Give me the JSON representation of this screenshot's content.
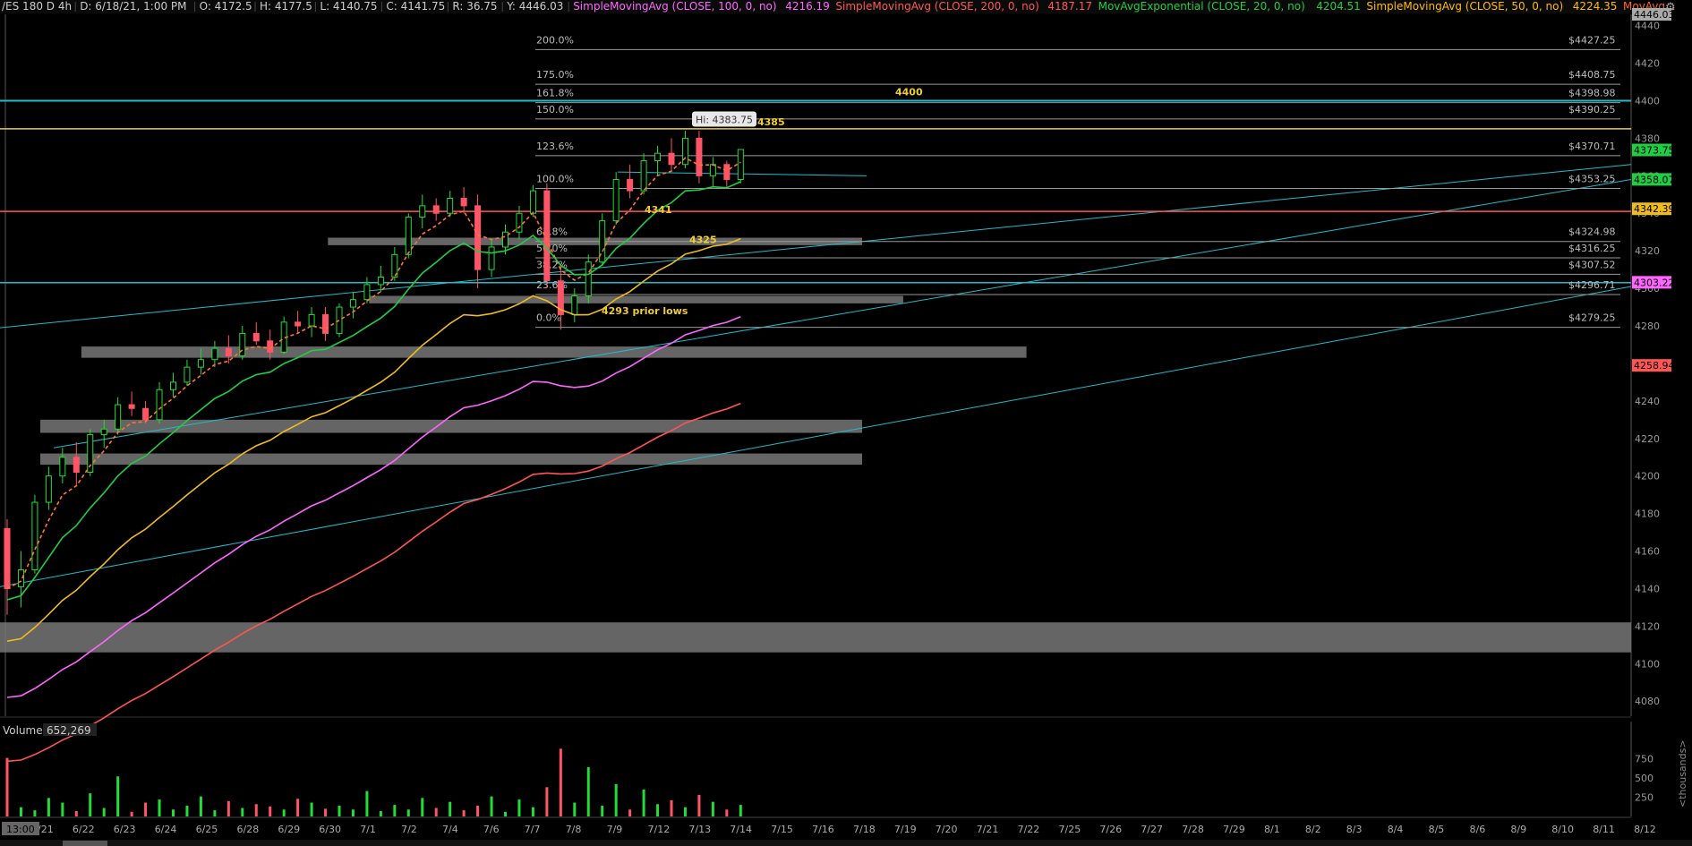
{
  "header": {
    "symbol": "/ES 180 D 4h",
    "date": "D: 6/18/21, 1:00 PM",
    "ohlc": "O: 4172.5",
    "high": "H: 4177.5",
    "low": "L: 4140.75",
    "close": "C: 4141.75",
    "range": "R: 36.75",
    "cursor_y": "Y: 4446.03",
    "studies": [
      {
        "label": "SimpleMovingAvg (CLOSE, 100, 0, no)",
        "value": "4216.19",
        "color": "#ff66ff"
      },
      {
        "label": "SimpleMovingAvg (CLOSE, 200, 0, no)",
        "value": "4187.17",
        "color": "#ff5555"
      },
      {
        "label": "MovAvgExponential (CLOSE, 20, 0, no)",
        "value": "4204.51",
        "color": "#22cc44"
      },
      {
        "label": "SimpleMovingAvg (CLOSE, 50, 0, no)",
        "value": "4224.35",
        "color": "#ffbb00"
      },
      {
        "label": "MovAvg...",
        "value": "",
        "color": "#ff6622"
      }
    ]
  },
  "colors": {
    "up": "#22dd33",
    "down": "#ff5566",
    "ema20": "#22cc44",
    "sma50": "#eebb22",
    "sma100": "#ff66ff",
    "sma200": "#ff5555",
    "trend": "#22bbcc",
    "yellow_line": "#eecc33",
    "fib": "#999999",
    "zone": "#777777"
  },
  "chart_data": [
    {
      "type": "candlestick",
      "x": {
        "ticks": [
          "6/21",
          "6/22",
          "6/23",
          "6/24",
          "6/25",
          "6/28",
          "6/29",
          "6/30",
          "7/1",
          "7/2",
          "7/4",
          "7/6",
          "7/7",
          "7/8",
          "7/9",
          "7/12",
          "7/13",
          "7/14",
          "7/15",
          "7/16",
          "7/18",
          "7/19",
          "7/20",
          "7/21",
          "7/22",
          "7/25",
          "7/26",
          "7/27",
          "7/28",
          "7/29",
          "8/1",
          "8/2",
          "8/3",
          "8/4",
          "8/5",
          "8/6",
          "8/9",
          "8/10",
          "8/11",
          "8/12"
        ],
        "cursor_label": "13:00"
      },
      "y": {
        "range": [
          4072,
          4446.03
        ],
        "ticks": [
          4080,
          4100,
          4120,
          4140,
          4160,
          4180,
          4200,
          4220,
          4240,
          4260,
          4280,
          4300,
          4320,
          4340,
          4360,
          4380,
          4400,
          4420,
          4440
        ],
        "right_flags": [
          {
            "label": "4446.03",
            "value": 4446.03,
            "color": "#aaaaaa"
          },
          {
            "label": "4373.75",
            "value": 4373.75,
            "color": "#22cc44"
          },
          {
            "label": "4358.07",
            "value": 4358.07,
            "color": "#22cc44"
          },
          {
            "label": "4342.39",
            "value": 4342.39,
            "color": "#eebb22"
          },
          {
            "label": "4303.22",
            "value": 4303.22,
            "color": "#ff66ff"
          },
          {
            "label": "4258.94",
            "value": 4258.94,
            "color": "#ff5555"
          }
        ]
      },
      "fib_levels": [
        {
          "pct": "200.0%",
          "price": "$4427.25",
          "value": 4427.25
        },
        {
          "pct": "175.0%",
          "price": "$4408.75",
          "value": 4408.75
        },
        {
          "pct": "161.8%",
          "price": "$4398.98",
          "value": 4398.98
        },
        {
          "pct": "150.0%",
          "price": "$4390.25",
          "value": 4390.25
        },
        {
          "pct": "123.6%",
          "price": "$4370.71",
          "value": 4370.71
        },
        {
          "pct": "100.0%",
          "price": "$4353.25",
          "value": 4353.25
        },
        {
          "pct": "61.8%",
          "price": "$4324.98",
          "value": 4324.98
        },
        {
          "pct": "50.0%",
          "price": "$4316.25",
          "value": 4316.25
        },
        {
          "pct": "38.2%",
          "price": "$4307.52",
          "value": 4307.52
        },
        {
          "pct": "23.6%",
          "price": "$4296.71",
          "value": 4296.71
        },
        {
          "pct": "0.0%",
          "price": "$4279.25",
          "value": 4279.25
        }
      ],
      "annotations": [
        {
          "text": "4400",
          "value": 4400
        },
        {
          "text": "4385",
          "value": 4385
        },
        {
          "text": "4341",
          "value": 4341
        },
        {
          "text": "4325",
          "value": 4325
        },
        {
          "text": "4293 prior lows",
          "value": 4293
        },
        {
          "text": "Hi: 4383.75",
          "value": 4383.75
        }
      ],
      "horizontal_lines": [
        {
          "value": 4400,
          "color": "#22bbcc"
        },
        {
          "value": 4385,
          "color": "#eecc33"
        },
        {
          "value": 4341,
          "color": "#ff5555"
        },
        {
          "value": 4303,
          "color": "#22bbcc"
        }
      ],
      "zones": [
        {
          "from": 4323,
          "to": 4327,
          "x_from": "6/30",
          "x_to": "7/18"
        },
        {
          "from": 4292,
          "to": 4296,
          "x_from": "7/1",
          "x_to": "7/19"
        },
        {
          "from": 4263,
          "to": 4269,
          "x_from": "6/22",
          "x_to": "7/22"
        },
        {
          "from": 4223,
          "to": 4230,
          "x_from": "6/21",
          "x_to": "7/18"
        },
        {
          "from": 4206,
          "to": 4212,
          "x_from": "6/21",
          "x_to": "7/18"
        },
        {
          "from": 4106,
          "to": 4122,
          "x_from": "6/18",
          "x_to": "8/12"
        }
      ],
      "candles": [
        [
          4172,
          4177,
          4126,
          4140
        ],
        [
          4141,
          4160,
          4130,
          4150
        ],
        [
          4150,
          4190,
          4148,
          4186
        ],
        [
          4186,
          4205,
          4182,
          4200
        ],
        [
          4200,
          4215,
          4196,
          4210
        ],
        [
          4210,
          4218,
          4195,
          4202
        ],
        [
          4202,
          4225,
          4200,
          4222
        ],
        [
          4222,
          4230,
          4215,
          4225
        ],
        [
          4225,
          4242,
          4222,
          4238
        ],
        [
          4238,
          4245,
          4232,
          4236
        ],
        [
          4236,
          4240,
          4228,
          4230
        ],
        [
          4230,
          4250,
          4228,
          4246
        ],
        [
          4246,
          4255,
          4242,
          4250
        ],
        [
          4250,
          4262,
          4248,
          4258
        ],
        [
          4258,
          4268,
          4254,
          4262
        ],
        [
          4262,
          4272,
          4258,
          4268
        ],
        [
          4268,
          4275,
          4260,
          4264
        ],
        [
          4264,
          4280,
          4262,
          4276
        ],
        [
          4276,
          4282,
          4270,
          4272
        ],
        [
          4272,
          4278,
          4262,
          4266
        ],
        [
          4266,
          4285,
          4265,
          4282
        ],
        [
          4282,
          4288,
          4276,
          4280
        ],
        [
          4280,
          4290,
          4274,
          4286
        ],
        [
          4286,
          4290,
          4272,
          4276
        ],
        [
          4276,
          4292,
          4274,
          4290
        ],
        [
          4290,
          4298,
          4284,
          4294
        ],
        [
          4294,
          4306,
          4292,
          4302
        ],
        [
          4302,
          4312,
          4298,
          4306
        ],
        [
          4306,
          4322,
          4304,
          4318
        ],
        [
          4318,
          4340,
          4316,
          4338
        ],
        [
          4338,
          4350,
          4332,
          4344
        ],
        [
          4344,
          4348,
          4336,
          4340
        ],
        [
          4340,
          4352,
          4338,
          4348
        ],
        [
          4348,
          4354,
          4340,
          4344
        ],
        [
          4344,
          4350,
          4300,
          4310
        ],
        [
          4310,
          4326,
          4306,
          4322
        ],
        [
          4322,
          4334,
          4318,
          4330
        ],
        [
          4330,
          4344,
          4326,
          4340
        ],
        [
          4340,
          4355,
          4338,
          4352
        ],
        [
          4352,
          4356,
          4300,
          4304
        ],
        [
          4304,
          4312,
          4278,
          4286
        ],
        [
          4286,
          4300,
          4282,
          4296
        ],
        [
          4296,
          4318,
          4292,
          4314
        ],
        [
          4314,
          4340,
          4312,
          4336
        ],
        [
          4336,
          4362,
          4334,
          4358
        ],
        [
          4358,
          4366,
          4348,
          4352
        ],
        [
          4352,
          4372,
          4350,
          4368
        ],
        [
          4368,
          4376,
          4360,
          4372
        ],
        [
          4372,
          4380,
          4362,
          4366
        ],
        [
          4366,
          4384,
          4364,
          4380
        ],
        [
          4380,
          4384,
          4356,
          4360
        ],
        [
          4360,
          4370,
          4354,
          4366
        ],
        [
          4366,
          4368,
          4354,
          4358
        ],
        [
          4358,
          4374,
          4356,
          4374
        ]
      ],
      "candle_x_start": "6/18",
      "candle_x_end": "7/14"
    },
    {
      "type": "bar",
      "title": "Volume",
      "current_value": "652,269",
      "y": {
        "range": [
          0,
          1000
        ],
        "ticks": [
          250,
          500,
          750
        ],
        "unit_label": "<thousands>"
      },
      "values": [
        760,
        120,
        80,
        240,
        180,
        70,
        300,
        110,
        520,
        60,
        180,
        220,
        90,
        140,
        260,
        80,
        200,
        110,
        160,
        130,
        90,
        230,
        180,
        100,
        140,
        90,
        330,
        70,
        150,
        90,
        240,
        110,
        190,
        80,
        140,
        260,
        60,
        220,
        120,
        380,
        880,
        180,
        640,
        140,
        420,
        90,
        350,
        160,
        210,
        120,
        280,
        190,
        90,
        150
      ]
    }
  ]
}
